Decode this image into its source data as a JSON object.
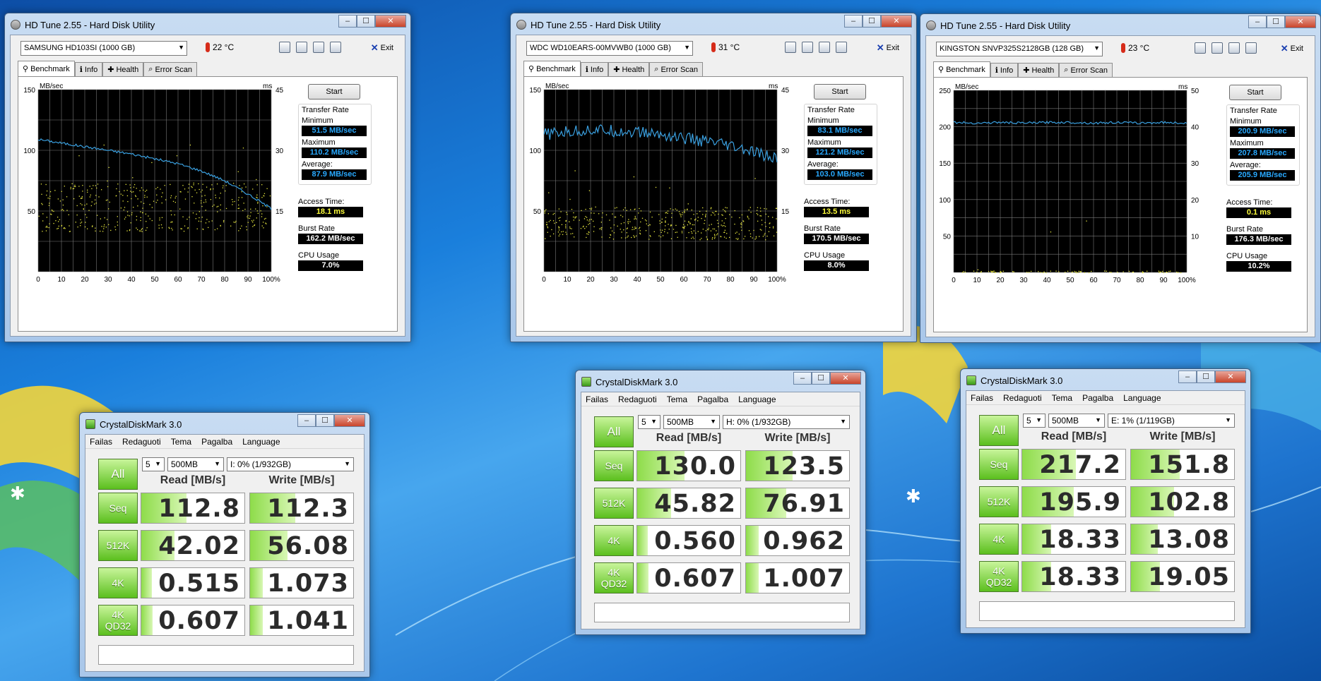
{
  "hdtune": [
    {
      "title": "HD Tune 2.55 - Hard Disk Utility",
      "drive": "SAMSUNG HD103SI (1000 GB)",
      "temperature": "22 °C",
      "exit_label": "Exit",
      "tabs": [
        "Benchmark",
        "Info",
        "Health",
        "Error Scan"
      ],
      "start_label": "Start",
      "transfer_rate_label": "Transfer Rate",
      "minimum_label": "Minimum",
      "minimum": "51.5 MB/sec",
      "maximum_label": "Maximum",
      "maximum": "110.2 MB/sec",
      "average_label": "Average:",
      "average": "87.9 MB/sec",
      "access_time_label": "Access Time:",
      "access_time": "18.1 ms",
      "burst_rate_label": "Burst Rate",
      "burst_rate": "162.2 MB/sec",
      "cpu_usage_label": "CPU Usage",
      "cpu_usage": "7.0%",
      "chart_data": {
        "type": "line",
        "ylabel": "MB/sec",
        "y2label": "ms",
        "ylim": [
          0,
          150
        ],
        "y2lim": [
          0,
          45
        ],
        "y_ticks": [
          "150",
          "100",
          "50"
        ],
        "y2_ticks": [
          "45",
          "30",
          "15"
        ],
        "x_ticks": [
          "0",
          "10",
          "20",
          "30",
          "40",
          "50",
          "60",
          "70",
          "80",
          "90",
          "100%"
        ],
        "series": [
          {
            "x": [
              0,
              10,
              20,
              30,
              40,
              50,
              60,
              70,
              80,
              90,
              100
            ],
            "values": [
              109,
              106,
              103,
              100,
              97,
              93,
              89,
              83,
              75,
              64,
              52
            ]
          }
        ],
        "access_scatter_band_ms": [
          10,
          22
        ],
        "colors": {
          "line": "#3aa0e0",
          "scatter": "#e8e840",
          "grid": "#7a7a7a"
        }
      }
    },
    {
      "title": "HD Tune 2.55 - Hard Disk Utility",
      "drive": "WDC WD10EARS-00MVWB0 (1000 GB)",
      "temperature": "31 °C",
      "exit_label": "Exit",
      "tabs": [
        "Benchmark",
        "Info",
        "Health",
        "Error Scan"
      ],
      "start_label": "Start",
      "transfer_rate_label": "Transfer Rate",
      "minimum_label": "Minimum",
      "minimum": "83.1 MB/sec",
      "maximum_label": "Maximum",
      "maximum": "121.2 MB/sec",
      "average_label": "Average:",
      "average": "103.0 MB/sec",
      "access_time_label": "Access Time:",
      "access_time": "13.5 ms",
      "burst_rate_label": "Burst Rate",
      "burst_rate": "170.5 MB/sec",
      "cpu_usage_label": "CPU Usage",
      "cpu_usage": "8.0%",
      "chart_data": {
        "type": "line",
        "ylabel": "MB/sec",
        "y2label": "ms",
        "ylim": [
          0,
          150
        ],
        "y2lim": [
          0,
          45
        ],
        "y_ticks": [
          "150",
          "100",
          "50"
        ],
        "y2_ticks": [
          "45",
          "30",
          "15"
        ],
        "x_ticks": [
          "0",
          "10",
          "20",
          "30",
          "40",
          "50",
          "60",
          "70",
          "80",
          "90",
          "100%"
        ],
        "series": [
          {
            "x": [
              0,
              10,
              20,
              30,
              40,
              50,
              60,
              70,
              80,
              90,
              100
            ],
            "values": [
              113,
              115,
              117,
              116,
              115,
              113,
              110,
              107,
              103,
              98,
              93
            ]
          }
        ],
        "access_scatter_band_ms": [
          8,
          16
        ],
        "colors": {
          "line": "#3aa0e0",
          "scatter": "#e8e840",
          "grid": "#7a7a7a"
        }
      }
    },
    {
      "title": "HD Tune 2.55 - Hard Disk Utility",
      "drive": "KINGSTON SNVP325S2128GB (128 GB)",
      "temperature": "23 °C",
      "exit_label": "Exit",
      "tabs": [
        "Benchmark",
        "Info",
        "Health",
        "Error Scan"
      ],
      "start_label": "Start",
      "transfer_rate_label": "Transfer Rate",
      "minimum_label": "Minimum",
      "minimum": "200.9 MB/sec",
      "maximum_label": "Maximum",
      "maximum": "207.8 MB/sec",
      "average_label": "Average:",
      "average": "205.9 MB/sec",
      "access_time_label": "Access Time:",
      "access_time": "0.1 ms",
      "burst_rate_label": "Burst Rate",
      "burst_rate": "176.3 MB/sec",
      "cpu_usage_label": "CPU Usage",
      "cpu_usage": "10.2%",
      "chart_data": {
        "type": "line",
        "ylabel": "MB/sec",
        "y2label": "ms",
        "ylim": [
          0,
          250
        ],
        "y2lim": [
          0,
          50
        ],
        "y_ticks": [
          "250",
          "200",
          "150",
          "100",
          "50"
        ],
        "y2_ticks": [
          "50",
          "40",
          "30",
          "20",
          "10"
        ],
        "x_ticks": [
          "0",
          "10",
          "20",
          "30",
          "40",
          "50",
          "60",
          "70",
          "80",
          "90",
          "100%"
        ],
        "series": [
          {
            "x": [
              0,
              10,
              20,
              30,
              40,
              50,
              60,
              70,
              80,
              90,
              100
            ],
            "values": [
              206,
              205,
              206,
              205,
              206,
              206,
              205,
              206,
              205,
              206,
              205
            ]
          }
        ],
        "access_scatter_band_ms": [
          0,
          0.5
        ],
        "colors": {
          "line": "#3aa0e0",
          "scatter": "#e8e840",
          "grid": "#7a7a7a"
        }
      }
    }
  ],
  "cdm": [
    {
      "title": "CrystalDiskMark 3.0",
      "menu": [
        "Failas",
        "Redaguoti",
        "Tema",
        "Pagalba",
        "Language"
      ],
      "all_label": "All",
      "count": "5",
      "size": "500MB",
      "drive": "I: 0% (1/932GB)",
      "read_header": "Read [MB/s]",
      "write_header": "Write [MB/s]",
      "rows": [
        {
          "label": "Seq",
          "read": "112.8",
          "write": "112.3",
          "read_fill": 0.44,
          "write_fill": 0.44
        },
        {
          "label": "512K",
          "read": "42.02",
          "write": "56.08",
          "read_fill": 0.32,
          "write_fill": 0.36
        },
        {
          "label": "4K",
          "read": "0.515",
          "write": "1.073",
          "read_fill": 0.1,
          "write_fill": 0.12
        },
        {
          "label": "4K\nQD32",
          "read": "0.607",
          "write": "1.041",
          "read_fill": 0.11,
          "write_fill": 0.12
        }
      ]
    },
    {
      "title": "CrystalDiskMark 3.0",
      "menu": [
        "Failas",
        "Redaguoti",
        "Tema",
        "Pagalba",
        "Language"
      ],
      "all_label": "All",
      "count": "5",
      "size": "500MB",
      "drive": "H: 0% (1/932GB)",
      "read_header": "Read [MB/s]",
      "write_header": "Write [MB/s]",
      "rows": [
        {
          "label": "Seq",
          "read": "130.0",
          "write": "123.5",
          "read_fill": 0.46,
          "write_fill": 0.45
        },
        {
          "label": "512K",
          "read": "45.82",
          "write": "76.91",
          "read_fill": 0.33,
          "write_fill": 0.39
        },
        {
          "label": "4K",
          "read": "0.560",
          "write": "0.962",
          "read_fill": 0.1,
          "write_fill": 0.12
        },
        {
          "label": "4K\nQD32",
          "read": "0.607",
          "write": "1.007",
          "read_fill": 0.11,
          "write_fill": 0.12
        }
      ]
    },
    {
      "title": "CrystalDiskMark 3.0",
      "menu": [
        "Failas",
        "Redaguoti",
        "Tema",
        "Pagalba",
        "Language"
      ],
      "all_label": "All",
      "count": "5",
      "size": "500MB",
      "drive": "E: 1% (1/119GB)",
      "read_header": "Read [MB/s]",
      "write_header": "Write [MB/s]",
      "rows": [
        {
          "label": "Seq",
          "read": "217.2",
          "write": "151.8",
          "read_fill": 0.52,
          "write_fill": 0.47
        },
        {
          "label": "512K",
          "read": "195.9",
          "write": "102.8",
          "read_fill": 0.5,
          "write_fill": 0.42
        },
        {
          "label": "4K",
          "read": "18.33",
          "write": "13.08",
          "read_fill": 0.28,
          "write_fill": 0.26
        },
        {
          "label": "4K\nQD32",
          "read": "18.33",
          "write": "19.05",
          "read_fill": 0.28,
          "write_fill": 0.28
        }
      ]
    }
  ]
}
